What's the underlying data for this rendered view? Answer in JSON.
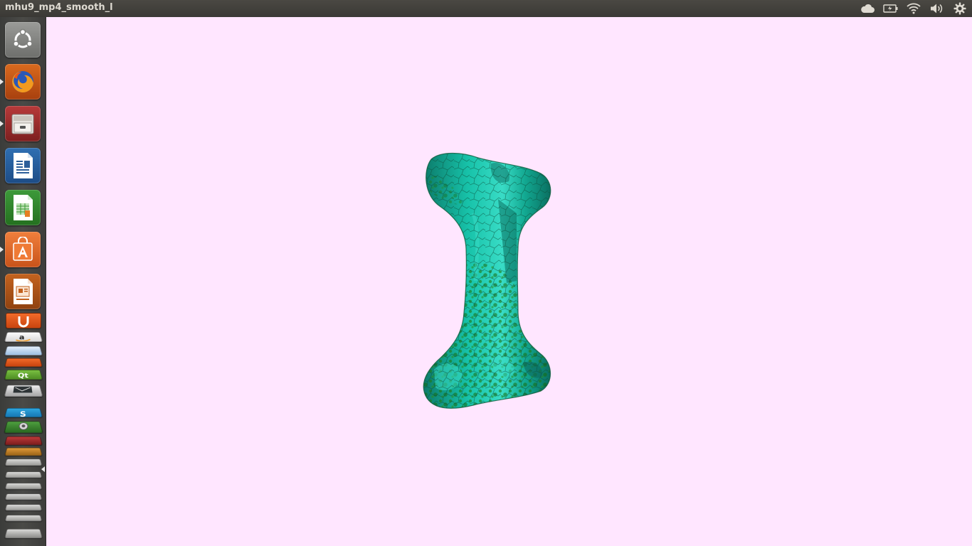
{
  "window": {
    "title": "mhu9_mp4_smooth_l"
  },
  "panel": {
    "indicators": [
      "cloud-icon",
      "battery-icon",
      "wifi-icon",
      "volume-icon",
      "settings-gear-icon"
    ]
  },
  "launcher": {
    "items": [
      {
        "name": "ubuntu-dash",
        "icon": "ubuntu-logo-icon"
      },
      {
        "name": "firefox",
        "icon": "firefox-icon",
        "running": true
      },
      {
        "name": "files",
        "icon": "file-cabinet-icon",
        "running": true
      },
      {
        "name": "libreoffice-writer",
        "icon": "writer-document-icon"
      },
      {
        "name": "libreoffice-calc",
        "icon": "calc-spreadsheet-icon"
      },
      {
        "name": "ubuntu-software-center",
        "icon": "software-center-icon",
        "running": true
      },
      {
        "name": "libreoffice-impress",
        "icon": "impress-presentation-icon"
      }
    ],
    "stack": [
      "ubuntu-one-icon",
      "amazon-icon",
      "mysql-workbench-icon",
      "ubuntu-one-icon",
      "qt-creator-icon",
      "system-tool-icon",
      "skype-icon",
      "terminal-icon",
      "workspace-switcher-icon",
      "trash-icon"
    ]
  },
  "viewport": {
    "background": "#ffe6ff",
    "model": "smoothed bone-like mesh",
    "colors": {
      "surface": "#17c2a9",
      "highlight": "#3fe3cf",
      "shadow": "#0b6b60",
      "texture": "#1f7a12"
    }
  }
}
